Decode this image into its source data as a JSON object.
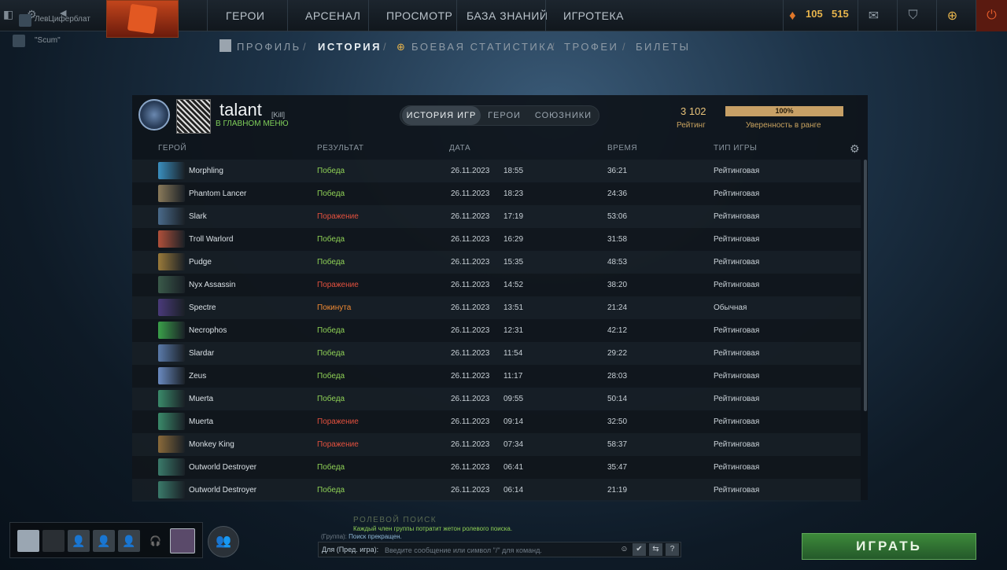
{
  "topbar": {
    "users": [
      {
        "name": "ЛевЦиферблат"
      },
      {
        "name": "\"Scum\""
      }
    ],
    "nav": [
      "ГЕРОИ",
      "АРСЕНАЛ",
      "ПРОСМОТР",
      "БАЗА ЗНАНИЙ",
      "ИГРОТЕКА"
    ],
    "shards": "105",
    "coins": "515",
    "icons": [
      "mail-icon",
      "armory-icon",
      "plus-icon",
      "power-icon"
    ]
  },
  "subnav": {
    "items": [
      "ПРОФИЛЬ",
      "ИСТОРИЯ",
      "БОЕВАЯ СТАТИСТИКА",
      "ТРОФЕИ",
      "БИЛЕТЫ"
    ],
    "separator": "/",
    "active": "ИСТОРИЯ"
  },
  "profile": {
    "name": "talant",
    "tag": "[Kill]",
    "status": "В ГЛАВНОМ МЕНЮ",
    "rating_value": "3 102",
    "rating_label": "Рейтинг",
    "confidence_value": "100%",
    "confidence_fraction": 1.0,
    "confidence_label": "Уверенность в ранге"
  },
  "tabs": [
    "ИСТОРИЯ ИГР",
    "ГЕРОИ",
    "СОЮЗНИКИ"
  ],
  "columns": [
    "ГЕРОЙ",
    "РЕЗУЛЬТАТ",
    "ДАТА",
    "ВРЕМЯ",
    "ТИП ИГРЫ"
  ],
  "matches": [
    {
      "hero": "Morphling",
      "result": "Победа",
      "kind": "win",
      "date": "26.11.2023",
      "time": "18:55",
      "duration": "36:21",
      "type": "Рейтинговая",
      "color": "#3a8fbf"
    },
    {
      "hero": "Phantom Lancer",
      "result": "Победа",
      "kind": "win",
      "date": "26.11.2023",
      "time": "18:23",
      "duration": "24:36",
      "type": "Рейтинговая",
      "color": "#8a7a5a"
    },
    {
      "hero": "Slark",
      "result": "Поражение",
      "kind": "loss",
      "date": "26.11.2023",
      "time": "17:19",
      "duration": "53:06",
      "type": "Рейтинговая",
      "color": "#4a6a8a"
    },
    {
      "hero": "Troll Warlord",
      "result": "Победа",
      "kind": "win",
      "date": "26.11.2023",
      "time": "16:29",
      "duration": "31:58",
      "type": "Рейтинговая",
      "color": "#b0503a"
    },
    {
      "hero": "Pudge",
      "result": "Победа",
      "kind": "win",
      "date": "26.11.2023",
      "time": "15:35",
      "duration": "48:53",
      "type": "Рейтинговая",
      "color": "#9a7a3a"
    },
    {
      "hero": "Nyx Assassin",
      "result": "Поражение",
      "kind": "loss",
      "date": "26.11.2023",
      "time": "14:52",
      "duration": "38:20",
      "type": "Рейтинговая",
      "color": "#3a5a4a"
    },
    {
      "hero": "Spectre",
      "result": "Покинута",
      "kind": "abandon",
      "date": "26.11.2023",
      "time": "13:51",
      "duration": "21:24",
      "type": "Обычная",
      "color": "#4a3a7a"
    },
    {
      "hero": "Necrophos",
      "result": "Победа",
      "kind": "win",
      "date": "26.11.2023",
      "time": "12:31",
      "duration": "42:12",
      "type": "Рейтинговая",
      "color": "#3aa04a"
    },
    {
      "hero": "Slardar",
      "result": "Победа",
      "kind": "win",
      "date": "26.11.2023",
      "time": "11:54",
      "duration": "29:22",
      "type": "Рейтинговая",
      "color": "#5a7aaa"
    },
    {
      "hero": "Zeus",
      "result": "Победа",
      "kind": "win",
      "date": "26.11.2023",
      "time": "11:17",
      "duration": "28:03",
      "type": "Рейтинговая",
      "color": "#6a8ac0"
    },
    {
      "hero": "Muerta",
      "result": "Победа",
      "kind": "win",
      "date": "26.11.2023",
      "time": "09:55",
      "duration": "50:14",
      "type": "Рейтинговая",
      "color": "#3a8a6a"
    },
    {
      "hero": "Muerta",
      "result": "Поражение",
      "kind": "loss",
      "date": "26.11.2023",
      "time": "09:14",
      "duration": "32:50",
      "type": "Рейтинговая",
      "color": "#3a8a6a"
    },
    {
      "hero": "Monkey King",
      "result": "Поражение",
      "kind": "loss",
      "date": "26.11.2023",
      "time": "07:34",
      "duration": "58:37",
      "type": "Рейтинговая",
      "color": "#8a6a3a"
    },
    {
      "hero": "Outworld Destroyer",
      "result": "Победа",
      "kind": "win",
      "date": "26.11.2023",
      "time": "06:41",
      "duration": "35:47",
      "type": "Рейтинговая",
      "color": "#3a7a6a"
    },
    {
      "hero": "Outworld Destroyer",
      "result": "Победа",
      "kind": "win",
      "date": "26.11.2023",
      "time": "06:14",
      "duration": "21:19",
      "type": "Рейтинговая",
      "color": "#3a7a6a"
    }
  ],
  "chat": {
    "title": "РОЛЕВОЙ ПОИСК",
    "message1": "Каждый член группы потратит жетон ролевого поиска.",
    "message2_prefix": "(Группа):",
    "message2": "Поиск прекращен.",
    "channel": "Для (Пред. игра):",
    "placeholder": "Введите сообщение или символ \"/\" для команд."
  },
  "play_label": "ИГРАТЬ",
  "colors": {
    "win": "#8fd156",
    "loss": "#e4513e",
    "abandon": "#f08a33",
    "play": "#3d8a3a"
  }
}
